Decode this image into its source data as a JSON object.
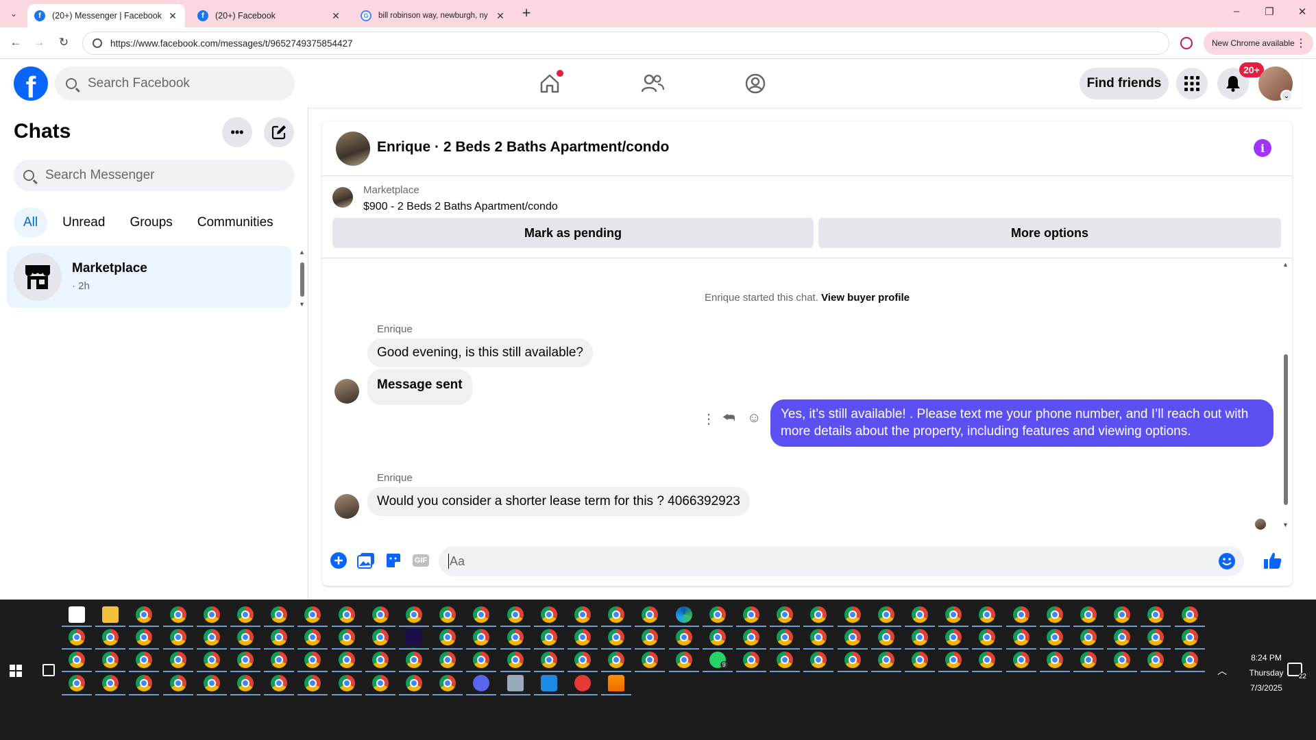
{
  "browser": {
    "tabs": [
      {
        "title": "(20+) Messenger | Facebook",
        "active": true,
        "icon": "facebook-icon"
      },
      {
        "title": "(20+) Facebook",
        "active": false,
        "icon": "facebook-icon"
      },
      {
        "title": "bill robinson way, newburgh, ny",
        "active": false,
        "icon": "google-icon"
      }
    ],
    "url": "https://www.facebook.com/messages/t/9652749375854427",
    "update_label": "New Chrome available"
  },
  "fb": {
    "search_placeholder": "Search Facebook",
    "find_friends": "Find friends",
    "notif_badge": "20+"
  },
  "chats": {
    "title": "Chats",
    "search_placeholder": "Search Messenger",
    "filters": [
      "All",
      "Unread",
      "Groups",
      "Communities"
    ],
    "threads": [
      {
        "name": "Marketplace",
        "time": "· 2h"
      }
    ]
  },
  "conversation": {
    "title": "Enrique · 2 Beds 2 Baths Apartment/condo",
    "listing_label": "Marketplace",
    "listing_price": "$900 - 2 Beds 2 Baths Apartment/condo",
    "mark_pending": "Mark as pending",
    "more_options": "More options",
    "system_text": "Enrique started this chat.",
    "system_link": "View buyer profile",
    "messages": [
      {
        "sender": "Enrique",
        "text": "Good evening, is this still available?"
      },
      {
        "sender": "",
        "text": "Message sent"
      },
      {
        "sender": "me",
        "text": "Yes, it’s still available! . Please text me your phone number, and I’ll reach out with more details about the property, including features and viewing options."
      },
      {
        "sender": "Enrique",
        "text": "Would you consider a shorter lease term for this ? 4066392923"
      }
    ],
    "composer_placeholder": "Aa",
    "gif_label": "GIF"
  },
  "taskbar": {
    "time": "8:24 PM",
    "day": "Thursday",
    "date": "7/3/2025",
    "notif_count": "22",
    "whatsapp_count": "9"
  },
  "colors": {
    "fb_blue": "#0866ff",
    "my_bubble": "#5b51f3",
    "tabbar": "#fbd7df"
  }
}
